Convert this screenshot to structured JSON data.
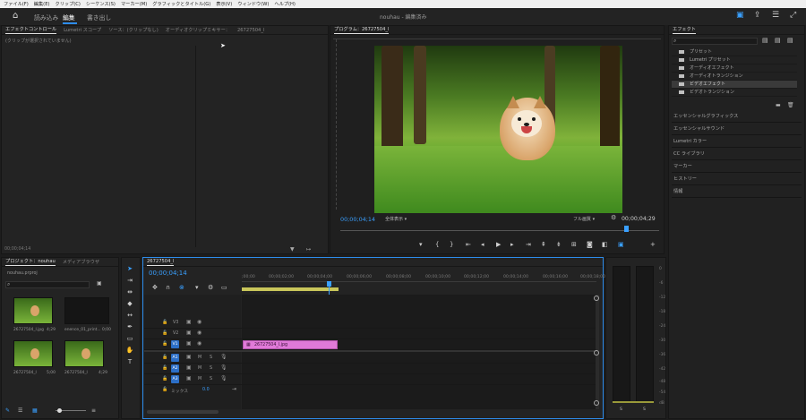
{
  "menu": [
    "ファイル(F)",
    "編集(E)",
    "クリップ(C)",
    "シーケンス(S)",
    "マーカー(M)",
    "グラフィックとタイトル(G)",
    "表示(V)",
    "ウィンドウ(W)",
    "ヘルプ(H)"
  ],
  "header": {
    "tabs": [
      "読み込み",
      "編集",
      "書き出し"
    ],
    "active_tab": "編集",
    "title": "nouhau - 編集済み",
    "home_icon": "home-icon",
    "right_icons": [
      "workspace-icon",
      "share-icon",
      "panel-menu-icon",
      "fullscreen-icon"
    ]
  },
  "source_panel": {
    "tabs": [
      "エフェクトコントロール",
      "Lumetri スコープ",
      "ソース：(クリップなし)",
      "オーディオクリップミキサー：",
      "26727504_l"
    ],
    "empty_message": "(クリップが選択されていません)",
    "footer_timecode": "00;00;04;14"
  },
  "program_monitor": {
    "title": "プログラム：26727504_l",
    "timecode_current": "00;00;04;14",
    "fit": "全体表示",
    "quality": "フル画質",
    "timecode_duration": "00;00;04;29",
    "transport_icons": [
      "marker-icon",
      "mark-in-icon",
      "mark-out-icon",
      "go-to-in-icon",
      "step-back-icon",
      "play-icon",
      "step-forward-icon",
      "go-to-out-icon",
      "lift-icon",
      "extract-icon",
      "export-frame-icon",
      "comparison-icon",
      "vr-icon",
      "add-button-icon"
    ]
  },
  "effects_panel": {
    "title": "エフェクト",
    "search_placeholder": "",
    "items": [
      "プリセット",
      "Lumetri プリセット",
      "オーディオエフェクト",
      "オーディオトランジション",
      "ビデオエフェクト",
      "ビデオトランジション"
    ],
    "selected_item": "ビデオエフェクト",
    "panels": [
      "エッセンシャルグラフィックス",
      "エッセンシャルサウンド",
      "Lumetri カラー",
      "CC ライブラリ",
      "マーカー",
      "ヒストリー",
      "情報"
    ]
  },
  "project_panel": {
    "tabs": [
      "プロジェクト：nouhau",
      "メディアブラウザ"
    ],
    "project_file": "nouhau.prproj",
    "items": [
      {
        "name": "26727504_l.jpg",
        "duration": "4;29"
      },
      {
        "name": "enence_01_print...",
        "duration": "0;00"
      },
      {
        "name": "26727504_l",
        "duration": "5;00"
      },
      {
        "name": "26727504_l",
        "duration": "4;29"
      }
    ]
  },
  "timeline": {
    "tab": "26727504_l",
    "timecode": "00;00;04;14",
    "ruler": [
      ";00;00",
      "00;00;02;00",
      "00;00;04;00",
      "00;00;06;00",
      "00;00;08;00",
      "00;00;10;00",
      "00;00;12;00",
      "00;00;14;00",
      "00;00;16;00",
      "00;00;18;00",
      "00;"
    ],
    "video_tracks": [
      "V3",
      "V2",
      "V1"
    ],
    "audio_tracks": [
      "A1",
      "A2",
      "A3"
    ],
    "mute": "M",
    "solo": "S",
    "mix_label": "ミックス",
    "mix_value": "0.0",
    "clip_name": "26727504_l.jpg"
  },
  "audio_meter": {
    "scale": [
      "0",
      "-6",
      "-12",
      "-18",
      "-24",
      "-30",
      "-36",
      "-42",
      "-48",
      "-54",
      "dB"
    ],
    "solo_left": "S",
    "solo_right": "S"
  },
  "colors": {
    "accent": "#2d8ceb",
    "timecode": "#3aa0ff",
    "clip": "#e07ad8",
    "background": "#1d1d1d"
  }
}
